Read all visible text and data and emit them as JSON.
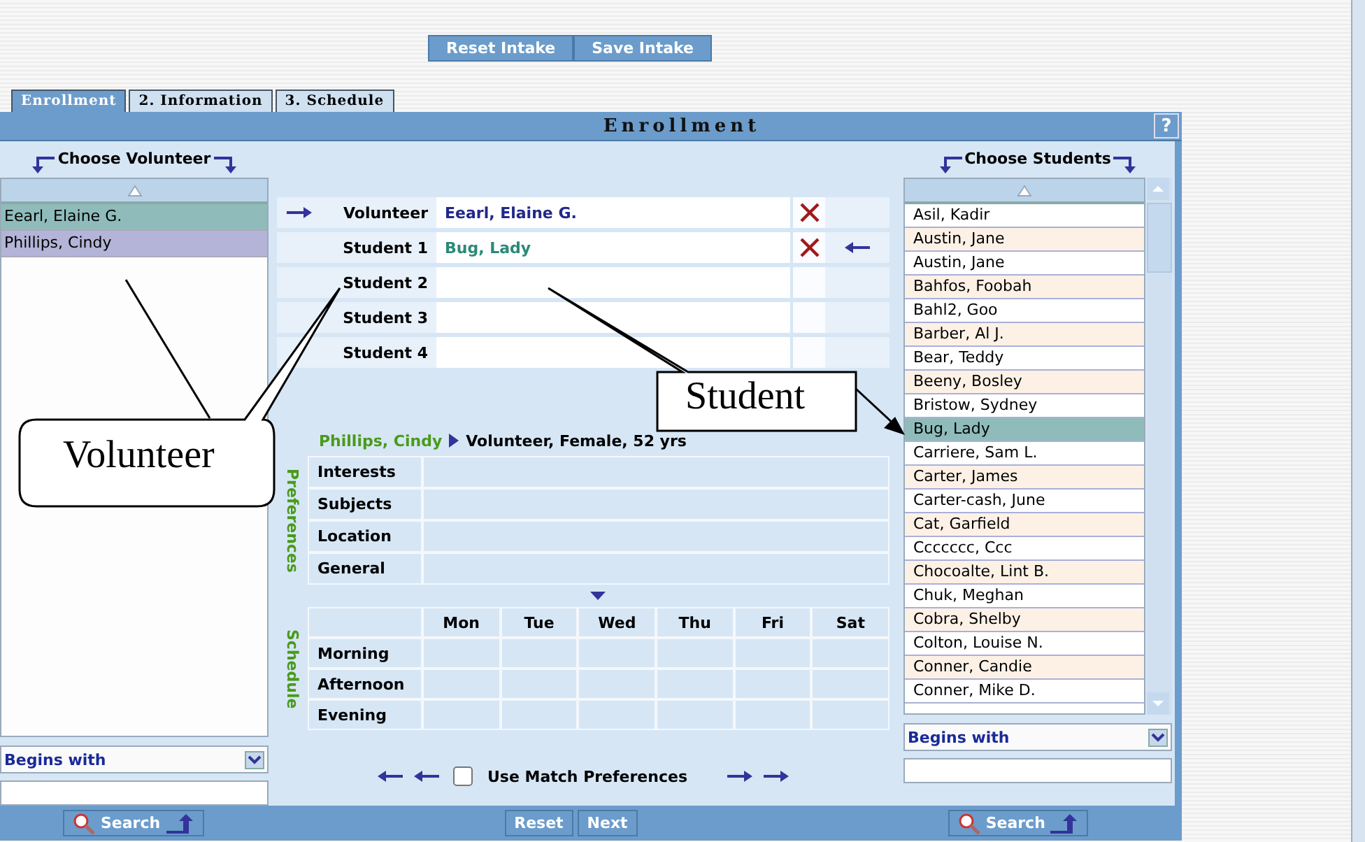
{
  "toolbar": {
    "buttons": [
      "Reset Intake",
      "Save Intake"
    ]
  },
  "tabs": [
    {
      "label": "Enrollment",
      "selected": true
    },
    {
      "label": "2. Information",
      "selected": false
    },
    {
      "label": "3. Schedule",
      "selected": false
    }
  ],
  "panel": {
    "title": "Enrollment",
    "help": "?"
  },
  "volunteers": {
    "title": "Choose Volunteer",
    "items": [
      {
        "name": "Eearl, Elaine G.",
        "selected": true
      },
      {
        "name": "Phillips, Cindy",
        "selected": false
      }
    ],
    "filter": "Begins with",
    "search": "Search"
  },
  "slots": [
    {
      "kind": "volunteer",
      "label": "Volunteer",
      "value": "Eearl, Elaine G.",
      "removable": true,
      "pointer": true
    },
    {
      "kind": "student",
      "label": "Student 1",
      "value": "Bug, Lady",
      "removable": true,
      "pointer": true
    },
    {
      "kind": "student",
      "label": "Student 2",
      "removable": false,
      "pointer": false
    },
    {
      "kind": "student",
      "label": "Student 3",
      "removable": false,
      "pointer": false
    },
    {
      "kind": "student",
      "label": "Student 4",
      "removable": false,
      "pointer": false
    }
  ],
  "info": {
    "name": "Phillips, Cindy",
    "details": "Volunteer, Female, 52 yrs"
  },
  "preferences": {
    "label": "Preferences",
    "rows": [
      "Interests",
      "Subjects",
      "Location",
      "General"
    ]
  },
  "schedule": {
    "label": "Schedule",
    "days": [
      "Mon",
      "Tue",
      "Wed",
      "Thu",
      "Fri",
      "Sat"
    ],
    "rows": [
      "Morning",
      "Afternoon",
      "Evening"
    ]
  },
  "match": {
    "label": "Use Match Preferences",
    "checked": false
  },
  "students": {
    "title": "Choose Students",
    "items": [
      {
        "name": "Asil, Kadir",
        "selected": false
      },
      {
        "name": "Austin, Jane",
        "selected": false
      },
      {
        "name": "Austin, Jane",
        "selected": false
      },
      {
        "name": "Bahfos, Foobah",
        "selected": false
      },
      {
        "name": "Bahl2, Goo",
        "selected": false
      },
      {
        "name": "Barber, Al J.",
        "selected": false
      },
      {
        "name": "Bear, Teddy",
        "selected": false
      },
      {
        "name": "Beeny, Bosley",
        "selected": false
      },
      {
        "name": "Bristow, Sydney",
        "selected": false
      },
      {
        "name": "Bug, Lady",
        "selected": true
      },
      {
        "name": "Carriere, Sam L.",
        "selected": false
      },
      {
        "name": "Carter, James",
        "selected": false
      },
      {
        "name": "Carter-cash, June",
        "selected": false
      },
      {
        "name": "Cat, Garfield",
        "selected": false
      },
      {
        "name": "Ccccccc, Ccc",
        "selected": false
      },
      {
        "name": "Chocoalte, Lint B.",
        "selected": false
      },
      {
        "name": "Chuk, Meghan",
        "selected": false
      },
      {
        "name": "Cobra, Shelby",
        "selected": false
      },
      {
        "name": "Colton, Louise N.",
        "selected": false
      },
      {
        "name": "Conner, Candie",
        "selected": false
      },
      {
        "name": "Conner, Mike D.",
        "selected": false
      }
    ],
    "filter": "Begins with",
    "search": "Search"
  },
  "footer": {
    "buttons": [
      "Reset",
      "Next"
    ]
  },
  "callouts": [
    {
      "text": "Volunteer"
    },
    {
      "text": "Student"
    }
  ]
}
